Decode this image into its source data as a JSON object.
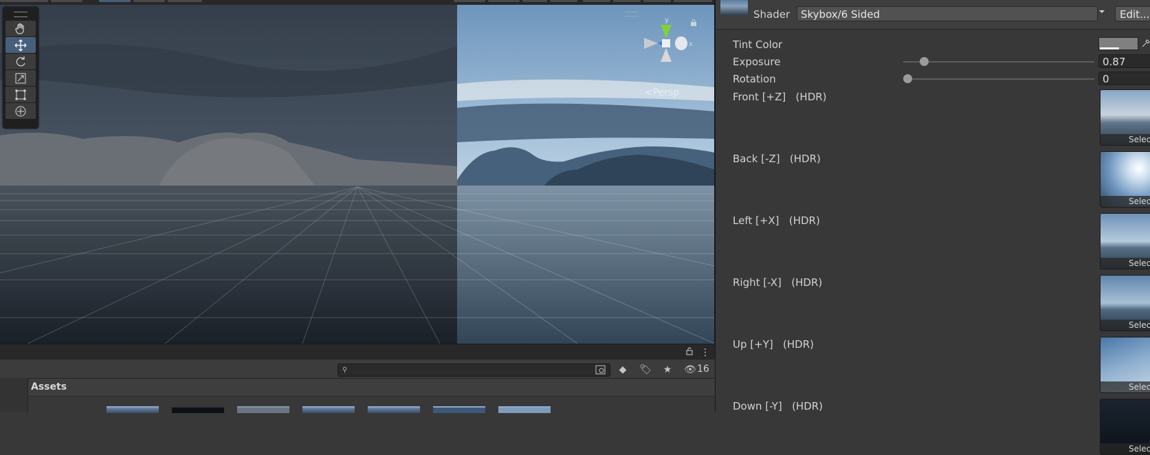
{
  "scene": {
    "view_mode": "Persp",
    "gizmo_axes": {
      "y": "y",
      "x": "x"
    }
  },
  "tool_palette": {
    "tools": [
      "hand-tool",
      "move-tool",
      "rotate-tool",
      "scale-tool",
      "rect-tool",
      "transform-tool"
    ],
    "active": "move-tool"
  },
  "project": {
    "search_placeholder": "",
    "hidden_count": "16",
    "breadcrumb": "Assets"
  },
  "inspector": {
    "shader_label": "Shader",
    "shader_value": "Skybox/6 Sided",
    "edit_label": "Edit...",
    "properties": {
      "tint": {
        "label": "Tint Color",
        "color": "#808080"
      },
      "exposure": {
        "label": "Exposure",
        "value": "0.87",
        "fraction": 0.087
      },
      "rotation": {
        "label": "Rotation",
        "value": "0",
        "fraction": 0
      }
    },
    "select_label": "Select",
    "textures": [
      {
        "label": "Front [+Z]   (HDR)"
      },
      {
        "label": "Back [-Z]   (HDR)"
      },
      {
        "label": "Left [+X]   (HDR)"
      },
      {
        "label": "Right [-X]   (HDR)"
      },
      {
        "label": "Up [+Y]   (HDR)"
      },
      {
        "label": "Down [-Y]   (HDR)"
      }
    ]
  }
}
